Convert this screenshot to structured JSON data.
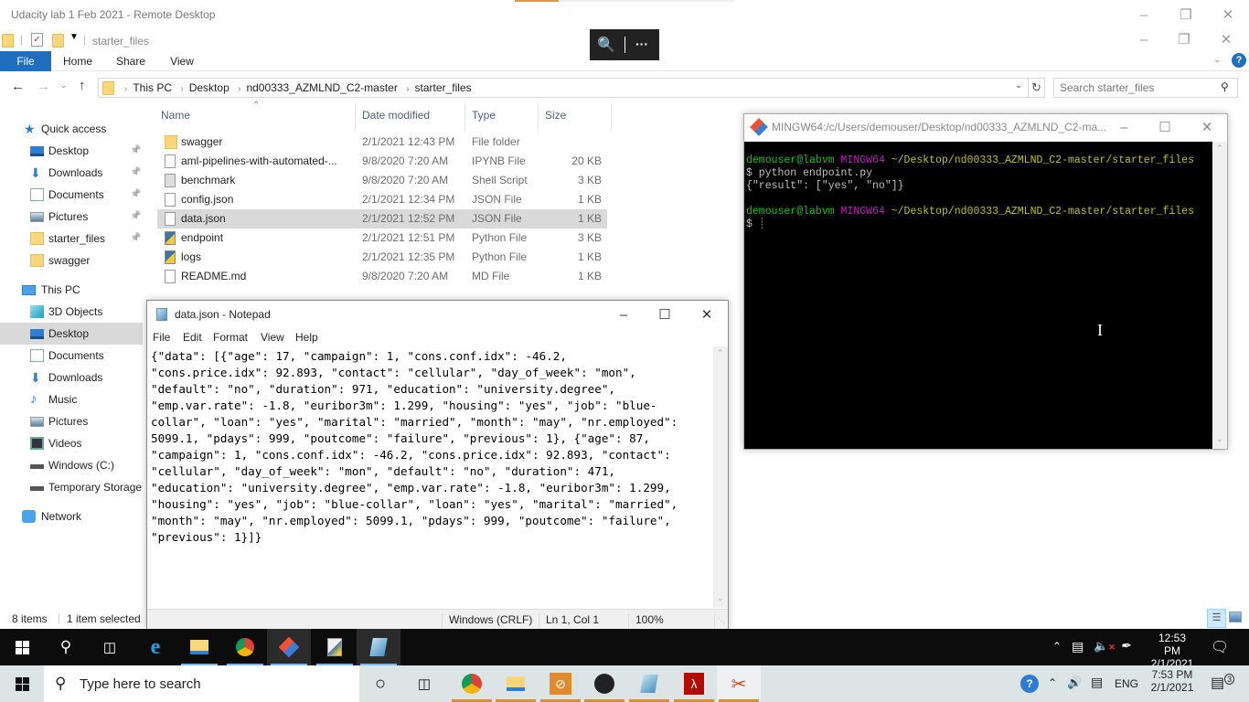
{
  "rdp": {
    "title": "Udacity lab 1 Feb 2021 - Remote Desktop",
    "toolbar": {
      "zoom_icon": "magnifier-plus-icon",
      "more_label": "···"
    }
  },
  "explorer": {
    "qat_title": "starter_files",
    "ribbon_tabs": [
      "File",
      "Home",
      "Share",
      "View"
    ],
    "breadcrumb": [
      "This PC",
      "Desktop",
      "nd00333_AZMLND_C2-master",
      "starter_files"
    ],
    "search_placeholder": "Search starter_files",
    "nav": {
      "quick_access_label": "Quick access",
      "quick_access": [
        {
          "label": "Desktop",
          "icon": "desktop-icon",
          "pinned": true
        },
        {
          "label": "Downloads",
          "icon": "downloads-icon",
          "pinned": true
        },
        {
          "label": "Documents",
          "icon": "documents-icon",
          "pinned": true
        },
        {
          "label": "Pictures",
          "icon": "pictures-icon",
          "pinned": true
        },
        {
          "label": "starter_files",
          "icon": "folder-icon",
          "pinned": true
        },
        {
          "label": "swagger",
          "icon": "folder-icon",
          "pinned": false
        }
      ],
      "this_pc_label": "This PC",
      "this_pc": [
        {
          "label": "3D Objects",
          "icon": "3d-objects-icon"
        },
        {
          "label": "Desktop",
          "icon": "desktop-icon",
          "selected": true
        },
        {
          "label": "Documents",
          "icon": "documents-icon"
        },
        {
          "label": "Downloads",
          "icon": "downloads-icon"
        },
        {
          "label": "Music",
          "icon": "music-icon"
        },
        {
          "label": "Pictures",
          "icon": "pictures-icon"
        },
        {
          "label": "Videos",
          "icon": "videos-icon"
        },
        {
          "label": "Windows (C:)",
          "icon": "drive-icon"
        },
        {
          "label": "Temporary Storage",
          "icon": "drive-icon"
        }
      ],
      "network_label": "Network"
    },
    "columns": [
      "Name",
      "Date modified",
      "Type",
      "Size"
    ],
    "files": [
      {
        "name": "swagger",
        "date": "2/1/2021 12:43 PM",
        "type": "File folder",
        "size": "",
        "icon": "folder"
      },
      {
        "name": "aml-pipelines-with-automated-...",
        "date": "9/8/2020 7:20 AM",
        "type": "IPYNB File",
        "size": "20 KB",
        "icon": "file"
      },
      {
        "name": "benchmark",
        "date": "9/8/2020 7:20 AM",
        "type": "Shell Script",
        "size": "3 KB",
        "icon": "sh"
      },
      {
        "name": "config.json",
        "date": "2/1/2021 12:34 PM",
        "type": "JSON File",
        "size": "1 KB",
        "icon": "file"
      },
      {
        "name": "data.json",
        "date": "2/1/2021 12:52 PM",
        "type": "JSON File",
        "size": "1 KB",
        "icon": "file",
        "selected": true
      },
      {
        "name": "endpoint",
        "date": "2/1/2021 12:51 PM",
        "type": "Python File",
        "size": "3 KB",
        "icon": "py"
      },
      {
        "name": "logs",
        "date": "2/1/2021 12:35 PM",
        "type": "Python File",
        "size": "1 KB",
        "icon": "py"
      },
      {
        "name": "README.md",
        "date": "9/8/2020 7:20 AM",
        "type": "MD File",
        "size": "1 KB",
        "icon": "file"
      }
    ],
    "status": {
      "items": "8 items",
      "selected": "1 item selected"
    }
  },
  "notepad": {
    "title": "data.json - Notepad",
    "menu": [
      "File",
      "Edit",
      "Format",
      "View",
      "Help"
    ],
    "content": "{\"data\": [{\"age\": 17, \"campaign\": 1, \"cons.conf.idx\": -46.2,\n\"cons.price.idx\": 92.893, \"contact\": \"cellular\", \"day_of_week\": \"mon\",\n\"default\": \"no\", \"duration\": 971, \"education\": \"university.degree\",\n\"emp.var.rate\": -1.8, \"euribor3m\": 1.299, \"housing\": \"yes\", \"job\": \"blue-\ncollar\", \"loan\": \"yes\", \"marital\": \"married\", \"month\": \"may\", \"nr.employed\":\n5099.1, \"pdays\": 999, \"poutcome\": \"failure\", \"previous\": 1}, {\"age\": 87,\n\"campaign\": 1, \"cons.conf.idx\": -46.2, \"cons.price.idx\": 92.893, \"contact\":\n\"cellular\", \"day_of_week\": \"mon\", \"default\": \"no\", \"duration\": 471,\n\"education\": \"university.degree\", \"emp.var.rate\": -1.8, \"euribor3m\": 1.299,\n\"housing\": \"yes\", \"job\": \"blue-collar\", \"loan\": \"yes\", \"marital\": \"married\",\n\"month\": \"may\", \"nr.employed\": 5099.1, \"pdays\": 999, \"poutcome\": \"failure\",\n\"previous\": 1}]}",
    "status": {
      "line_ending": "Windows (CRLF)",
      "position": "Ln 1, Col 1",
      "zoom": "100%"
    }
  },
  "terminal": {
    "title": "MINGW64:/c/Users/demouser/Desktop/nd00333_AZMLND_C2-ma...",
    "prompt_user": "demouser@labvm",
    "prompt_env": "MINGW64",
    "prompt_path": "~/Desktop/nd00333_AZMLND_C2-master/starter_files",
    "command": "$ python endpoint.py",
    "output": "{\"result\": [\"yes\", \"no\"]}",
    "prompt_symbol": "$"
  },
  "remote_taskbar": {
    "apps": [
      "start-icon",
      "search-icon",
      "task-view-icon",
      "internet-explorer-icon",
      "file-explorer-icon",
      "chrome-icon",
      "git-bash-icon",
      "python-file-icon",
      "notepad-icon"
    ],
    "time": "12:53 PM",
    "date": "2/1/2021"
  },
  "host_taskbar": {
    "search_placeholder": "Type here to search",
    "language": "ENG",
    "time": "7:53 PM",
    "date": "2/1/2021",
    "notification_count": "3"
  }
}
